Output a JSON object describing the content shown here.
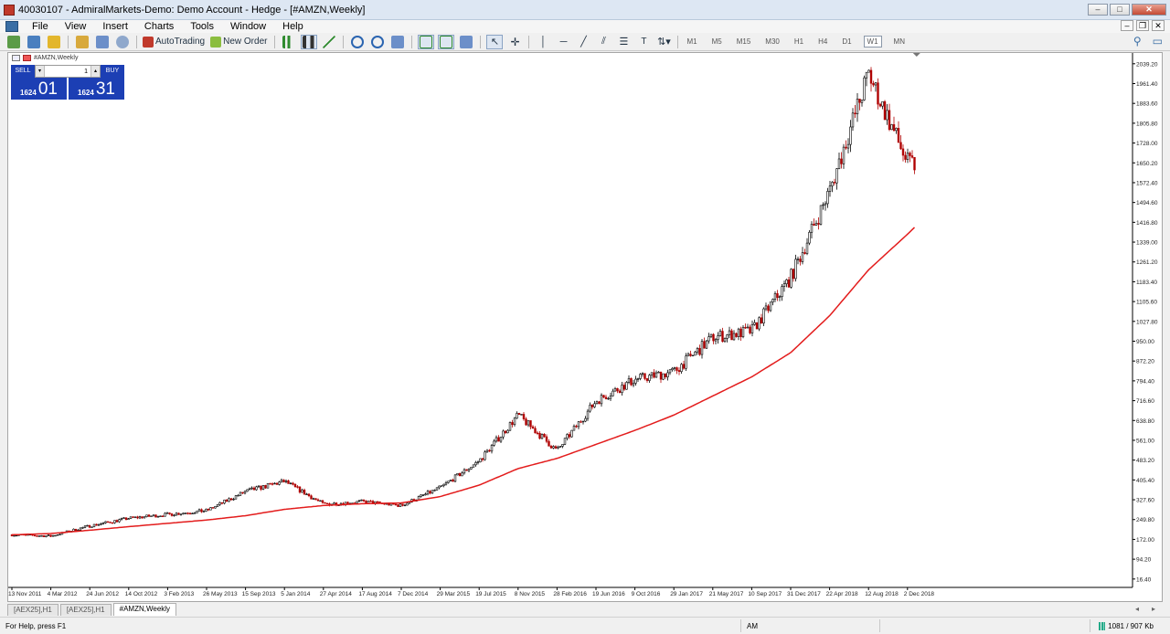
{
  "window": {
    "title": "40030107 - AdmiralMarkets-Demo: Demo Account - Hedge - [#AMZN,Weekly]"
  },
  "menu": [
    "File",
    "View",
    "Insert",
    "Charts",
    "Tools",
    "Window",
    "Help"
  ],
  "toolbar": {
    "autotrading_label": "AutoTrading",
    "new_order_label": "New Order",
    "timeframes": [
      "M1",
      "M5",
      "M15",
      "M30",
      "H1",
      "H4",
      "D1",
      "W1",
      "MN"
    ],
    "active_timeframe": "W1"
  },
  "chart": {
    "symbol_label": "#AMZN,Weekly",
    "one_click": {
      "sell_label": "SELL",
      "buy_label": "BUY",
      "lot": "1",
      "sell_price_small": "1624",
      "sell_price_big": "01",
      "buy_price_small": "1624",
      "buy_price_big": "31"
    }
  },
  "chart_data": {
    "type": "line",
    "title": "#AMZN,Weekly",
    "candle_up_color": "#000000",
    "candle_down_color": "#b00000",
    "ma_color": "#e31c1c",
    "grid": false,
    "y_ticks": [
      "2039.20",
      "1961.40",
      "1883.60",
      "1805.80",
      "1728.00",
      "1650.20",
      "1572.40",
      "1494.60",
      "1416.80",
      "1339.00",
      "1261.20",
      "1183.40",
      "1105.60",
      "1027.80",
      "950.00",
      "872.20",
      "794.40",
      "716.60",
      "638.80",
      "561.00",
      "483.20",
      "405.40",
      "327.60",
      "249.80",
      "172.00",
      "94.20",
      "16.40"
    ],
    "ylim": [
      5,
      2060
    ],
    "x_ticks": [
      "13 Nov 2011",
      "4 Mar 2012",
      "24 Jun 2012",
      "14 Oct 2012",
      "3 Feb 2013",
      "26 May 2013",
      "15 Sep 2013",
      "5 Jan 2014",
      "27 Apr 2014",
      "17 Aug 2014",
      "7 Dec 2014",
      "29 Mar 2015",
      "19 Jul 2015",
      "8 Nov 2015",
      "28 Feb 2016",
      "19 Jun 2016",
      "9 Oct 2016",
      "29 Jan 2017",
      "21 May 2017",
      "10 Sep 2017",
      "31 Dec 2017",
      "22 Apr 2018",
      "12 Aug 2018",
      "2 Dec 2018"
    ],
    "series": [
      {
        "name": "AMZN",
        "kind": "price-close-anchors",
        "x": [
          "13 Nov 2011",
          "4 Mar 2012",
          "24 Jun 2012",
          "14 Oct 2012",
          "3 Feb 2013",
          "26 May 2013",
          "15 Sep 2013",
          "5 Jan 2014",
          "27 Apr 2014",
          "17 Aug 2014",
          "7 Dec 2014",
          "29 Mar 2015",
          "19 Jul 2015",
          "8 Nov 2015",
          "28 Feb 2016",
          "19 Jun 2016",
          "9 Oct 2016",
          "29 Jan 2017",
          "21 May 2017",
          "10 Sep 2017",
          "31 Dec 2017",
          "22 Apr 2018",
          "12 Aug 2018",
          "2 Dec 2018",
          "30 Dec 2018"
        ],
        "values": [
          190,
          185,
          225,
          255,
          270,
          285,
          360,
          400,
          310,
          320,
          305,
          375,
          480,
          660,
          520,
          715,
          800,
          830,
          965,
          990,
          1200,
          1540,
          2000,
          1650,
          1640
        ]
      },
      {
        "name": "MA",
        "kind": "moving-average",
        "x": [
          "13 Nov 2011",
          "4 Mar 2012",
          "24 Jun 2012",
          "14 Oct 2012",
          "3 Feb 2013",
          "26 May 2013",
          "15 Sep 2013",
          "5 Jan 2014",
          "27 Apr 2014",
          "17 Aug 2014",
          "7 Dec 2014",
          "29 Mar 2015",
          "19 Jul 2015",
          "8 Nov 2015",
          "28 Feb 2016",
          "19 Jun 2016",
          "9 Oct 2016",
          "29 Jan 2017",
          "21 May 2017",
          "10 Sep 2017",
          "31 Dec 2017",
          "22 Apr 2018",
          "12 Aug 2018",
          "2 Dec 2018",
          "30 Dec 2018"
        ],
        "values": [
          190,
          195,
          208,
          222,
          235,
          248,
          265,
          290,
          305,
          312,
          315,
          340,
          385,
          450,
          490,
          545,
          600,
          660,
          735,
          810,
          905,
          1050,
          1230,
          1370,
          1405
        ]
      }
    ]
  },
  "tabs": [
    "[AEX25],H1",
    "[AEX25],H1",
    "#AMZN,Weekly"
  ],
  "active_tab": "#AMZN,Weekly",
  "status": {
    "help": "For Help, press F1",
    "profile": "AM",
    "traffic": "1081 / 907 Kb"
  }
}
